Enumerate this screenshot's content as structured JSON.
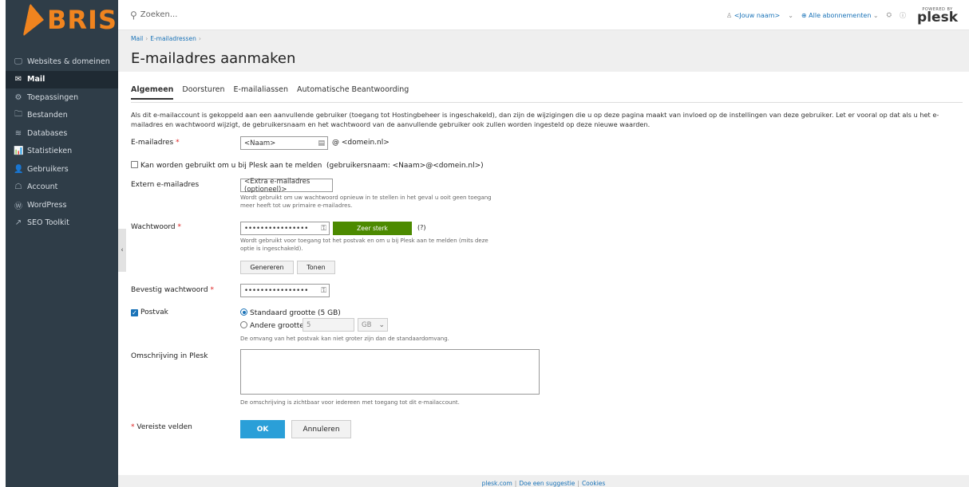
{
  "logo": {
    "text": "BRISP"
  },
  "sidebar": {
    "items": [
      {
        "icon": "monitor-icon",
        "glyph": "🖵",
        "label": "Websites & domeinen"
      },
      {
        "icon": "mail-icon",
        "glyph": "✉",
        "label": "Mail"
      },
      {
        "icon": "gear-icon",
        "glyph": "⚙",
        "label": "Toepassingen"
      },
      {
        "icon": "folder-icon",
        "glyph": "🗀",
        "label": "Bestanden"
      },
      {
        "icon": "database-icon",
        "glyph": "≋",
        "label": "Databases"
      },
      {
        "icon": "chart-icon",
        "glyph": "📊",
        "label": "Statistieken"
      },
      {
        "icon": "user-icon",
        "glyph": "👤",
        "label": "Gebruikers"
      },
      {
        "icon": "account-icon",
        "glyph": "☖",
        "label": "Account"
      },
      {
        "icon": "wordpress-icon",
        "glyph": "Ⓦ",
        "label": "WordPress"
      },
      {
        "icon": "seo-icon",
        "glyph": "↗",
        "label": "SEO Toolkit"
      }
    ],
    "collapse_glyph": "‹"
  },
  "topbar": {
    "search_placeholder": "Zoeken...",
    "user": "<Jouw naam>",
    "subscriptions": "Alle abonnementen",
    "powered_by": "POWERED BY",
    "brand": "plesk"
  },
  "breadcrumb": {
    "items": [
      "Mail",
      "E-mailadressen"
    ]
  },
  "page_title": "E-mailadres aanmaken",
  "tabs": [
    "Algemeen",
    "Doorsturen",
    "E-mailaliassen",
    "Automatische Beantwoording"
  ],
  "intro": "Als dit e-mailaccount is gekoppeld aan een aanvullende gebruiker (toegang tot Hostingbeheer is ingeschakeld), dan zijn de wijzigingen die u op deze pagina maakt van invloed op de instellingen van deze gebruiker. Let er vooral op dat als u het e-mailadres en wachtwoord wijzigt, de gebruikersnaam en het wachtwoord van de aanvullende gebruiker ook zullen worden ingesteld op deze nieuwe waarden.",
  "form": {
    "email_label": "E-mailadres",
    "email_value": "<Naam>",
    "at": "@",
    "domain": "<domein.nl>",
    "login_checkbox": "Kan worden gebruikt om u bij Plesk aan te melden",
    "login_username": "(gebruikersnaam: <Naam>@<domein.nl>)",
    "extern_label": "Extern e-mailadres",
    "extern_value": "<Extra e-mailadres (optioneel)>",
    "extern_hint": "Wordt gebruikt om uw wachtwoord opnieuw in te stellen in het geval u ooit geen toegang meer heeft tot uw primaire e-mailadres.",
    "password_label": "Wachtwoord",
    "password_value": "••••••••••••••••",
    "strength": "Zeer sterk",
    "strength_help": "(?)",
    "password_hint": "Wordt gebruikt voor toegang tot het postvak en om u bij Plesk aan te melden (mits deze optie is ingeschakeld).",
    "generate": "Genereren",
    "show": "Tonen",
    "confirm_label": "Bevestig wachtwoord",
    "confirm_value": "••••••••••••••••",
    "mailbox_label": "Postvak",
    "size_default": "Standaard grootte (5 GB)",
    "size_other": "Andere grootte",
    "size_value": "5",
    "size_unit": "GB",
    "size_hint": "De omvang van het postvak kan niet groter zijn dan de standaardomvang.",
    "desc_label": "Omschrijving in Plesk",
    "desc_hint": "De omschrijving is zichtbaar voor iedereen met toegang tot dit e-mailaccount.",
    "required_note": "Vereiste velden",
    "ok": "OK",
    "cancel": "Annuleren"
  },
  "footer": {
    "links": [
      "plesk.com",
      "Doe een suggestie",
      "Cookies"
    ]
  },
  "colors": {
    "sidebar": "#2f3d48",
    "brand": "#f0841f",
    "accent": "#2a9fd8",
    "strength": "#4c8a00"
  }
}
